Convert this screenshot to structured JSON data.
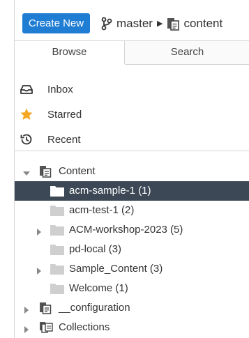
{
  "header": {
    "create_label": "Create New",
    "branch": "master",
    "repo": "content"
  },
  "tabs": {
    "browse": "Browse",
    "search": "Search"
  },
  "quick": [
    {
      "label": "Inbox",
      "icon": "inbox-icon"
    },
    {
      "label": "Starred",
      "icon": "star-icon"
    },
    {
      "label": "Recent",
      "icon": "recent-icon"
    }
  ],
  "tree": {
    "content": "Content",
    "items": [
      {
        "label": "acm-sample-1 (1)",
        "expandable": false,
        "selected": true
      },
      {
        "label": "acm-test-1 (2)",
        "expandable": false,
        "selected": false
      },
      {
        "label": "ACM-workshop-2023 (5)",
        "expandable": true,
        "selected": false
      },
      {
        "label": "pd-local (3)",
        "expandable": false,
        "selected": false
      },
      {
        "label": "Sample_Content (3)",
        "expandable": true,
        "selected": false
      },
      {
        "label": "Welcome (1)",
        "expandable": false,
        "selected": false
      }
    ],
    "configuration": "__configuration",
    "collections": "Collections"
  },
  "colors": {
    "accent": "#1f7ed4",
    "selected_row": "#3c4856",
    "star": "#f5a623",
    "folder": "#cfcfcf"
  }
}
